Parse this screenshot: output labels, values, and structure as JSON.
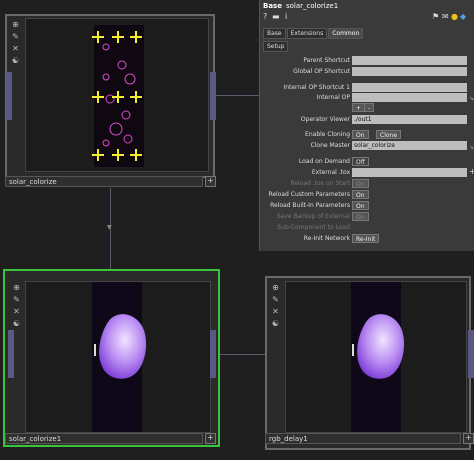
{
  "nodes": {
    "top_left": {
      "label": "solar_colorize",
      "plus": "+"
    },
    "bottom_left": {
      "label": "solar_colorize1",
      "plus": "+"
    },
    "bottom_right": {
      "label": "rgb_delay1",
      "plus": "+"
    }
  },
  "node_icons": [
    "⊕",
    "✎",
    "✕",
    "☯"
  ],
  "panel": {
    "type_label": "Base",
    "op_name": "solar_colorize1",
    "tabs": [
      "Base",
      "Extensions",
      "Common"
    ],
    "active_tab": "Common",
    "subtab": "Setup",
    "params": {
      "parent_shortcut": "Parent Shortcut",
      "global_op_shortcut": "Global OP Shortcut",
      "internal_op_shortcut": "Internal OP Shortcut 1",
      "internal_op": "Internal OP",
      "plus": "+",
      "minus": "-",
      "operator_viewer": "Operator Viewer",
      "operator_viewer_value": "./out1",
      "enable_cloning": "Enable Cloning",
      "enable_cloning_on": "On",
      "clone_btn": "Clone",
      "clone_master": "Clone Master",
      "clone_master_value": "solar_colorize",
      "load_on_demand": "Load on Demand",
      "load_on_demand_value": "Off",
      "external_tox": "External .tox",
      "reload_tox": "Reload .tox on Start",
      "reload_tox_value": "On",
      "reload_custom": "Reload Custom Parameters",
      "reload_custom_value": "On",
      "reload_builtin": "Reload Built-In Parameters",
      "reload_builtin_value": "On",
      "save_backup": "Save Backup of External",
      "save_backup_value": "On",
      "sub_component": "Sub-Component to Load",
      "reinit_network": "Re-Init Network",
      "reinit_btn": "Re-Init"
    }
  },
  "colors": {
    "selected_border": "#39c539",
    "viewer_bg": "#0e0818",
    "blob_light": "#f1e4ff",
    "blob_dark": "#7a3ad6",
    "marker_yellow": "#f4ef2e",
    "ring_pink": "#d84ad0"
  }
}
